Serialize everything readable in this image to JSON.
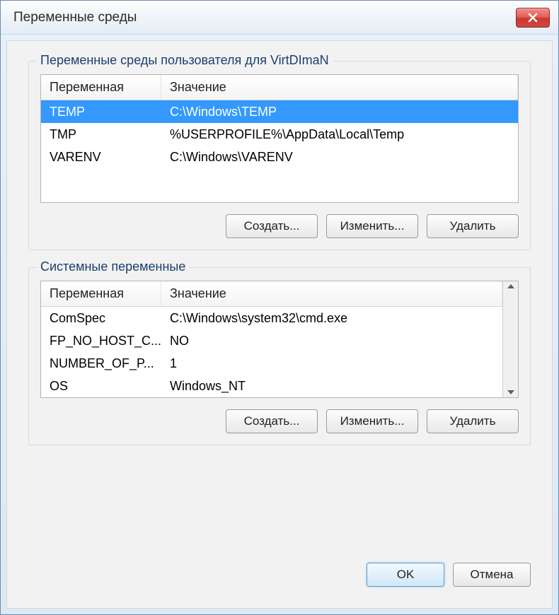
{
  "window": {
    "title": "Переменные среды"
  },
  "user_section": {
    "legend": "Переменные среды пользователя для VirtDImaN",
    "headers": {
      "var": "Переменная",
      "val": "Значение"
    },
    "rows": [
      {
        "var": "TEMP",
        "val": "C:\\Windows\\TEMP",
        "selected": true
      },
      {
        "var": "TMP",
        "val": "%USERPROFILE%\\AppData\\Local\\Temp",
        "selected": false
      },
      {
        "var": "VARENV",
        "val": "C:\\Windows\\VARENV",
        "selected": false
      }
    ],
    "buttons": {
      "create": "Создать...",
      "edit": "Изменить...",
      "delete": "Удалить"
    }
  },
  "system_section": {
    "legend": "Системные переменные",
    "headers": {
      "var": "Переменная",
      "val": "Значение"
    },
    "rows": [
      {
        "var": "ComSpec",
        "val": "C:\\Windows\\system32\\cmd.exe"
      },
      {
        "var": "FP_NO_HOST_C...",
        "val": "NO"
      },
      {
        "var": "NUMBER_OF_P...",
        "val": "1"
      },
      {
        "var": "OS",
        "val": "Windows_NT"
      }
    ],
    "buttons": {
      "create": "Создать...",
      "edit": "Изменить...",
      "delete": "Удалить"
    }
  },
  "dialog_buttons": {
    "ok": "OK",
    "cancel": "Отмена"
  }
}
